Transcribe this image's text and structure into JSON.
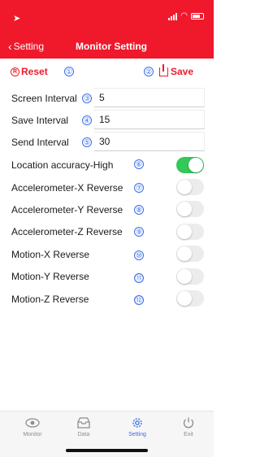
{
  "header": {
    "back_label": "Setting",
    "title": "Monitor Setting"
  },
  "actions": {
    "reset_label": "Reset",
    "save_label": "Save"
  },
  "markers": [
    "①",
    "②",
    "③",
    "④",
    "⑤",
    "⑥",
    "⑦",
    "⑧",
    "⑨",
    "⑩",
    "⑪",
    "⑫"
  ],
  "fields": [
    {
      "label": "Screen Interval",
      "value": "5"
    },
    {
      "label": "Save Interval",
      "value": "15"
    },
    {
      "label": "Send Interval",
      "value": "30"
    }
  ],
  "toggles": [
    {
      "label": "Location accuracy-High",
      "on": true
    },
    {
      "label": "Accelerometer-X Reverse",
      "on": false
    },
    {
      "label": "Accelerometer-Y Reverse",
      "on": false
    },
    {
      "label": "Accelerometer-Z Reverse",
      "on": false
    },
    {
      "label": "Motion-X Reverse",
      "on": false
    },
    {
      "label": "Motion-Y Reverse",
      "on": false
    },
    {
      "label": "Motion-Z Reverse",
      "on": false
    }
  ],
  "tabs": [
    {
      "label": "Monitor",
      "icon": "eye-icon"
    },
    {
      "label": "Data",
      "icon": "inbox-icon"
    },
    {
      "label": "Setting",
      "icon": "gear-icon",
      "active": true
    },
    {
      "label": "Exit",
      "icon": "power-icon"
    }
  ],
  "colors": {
    "brand_red": "#f0192c",
    "accent_blue": "#3a6ee8",
    "toggle_on": "#34c759"
  }
}
